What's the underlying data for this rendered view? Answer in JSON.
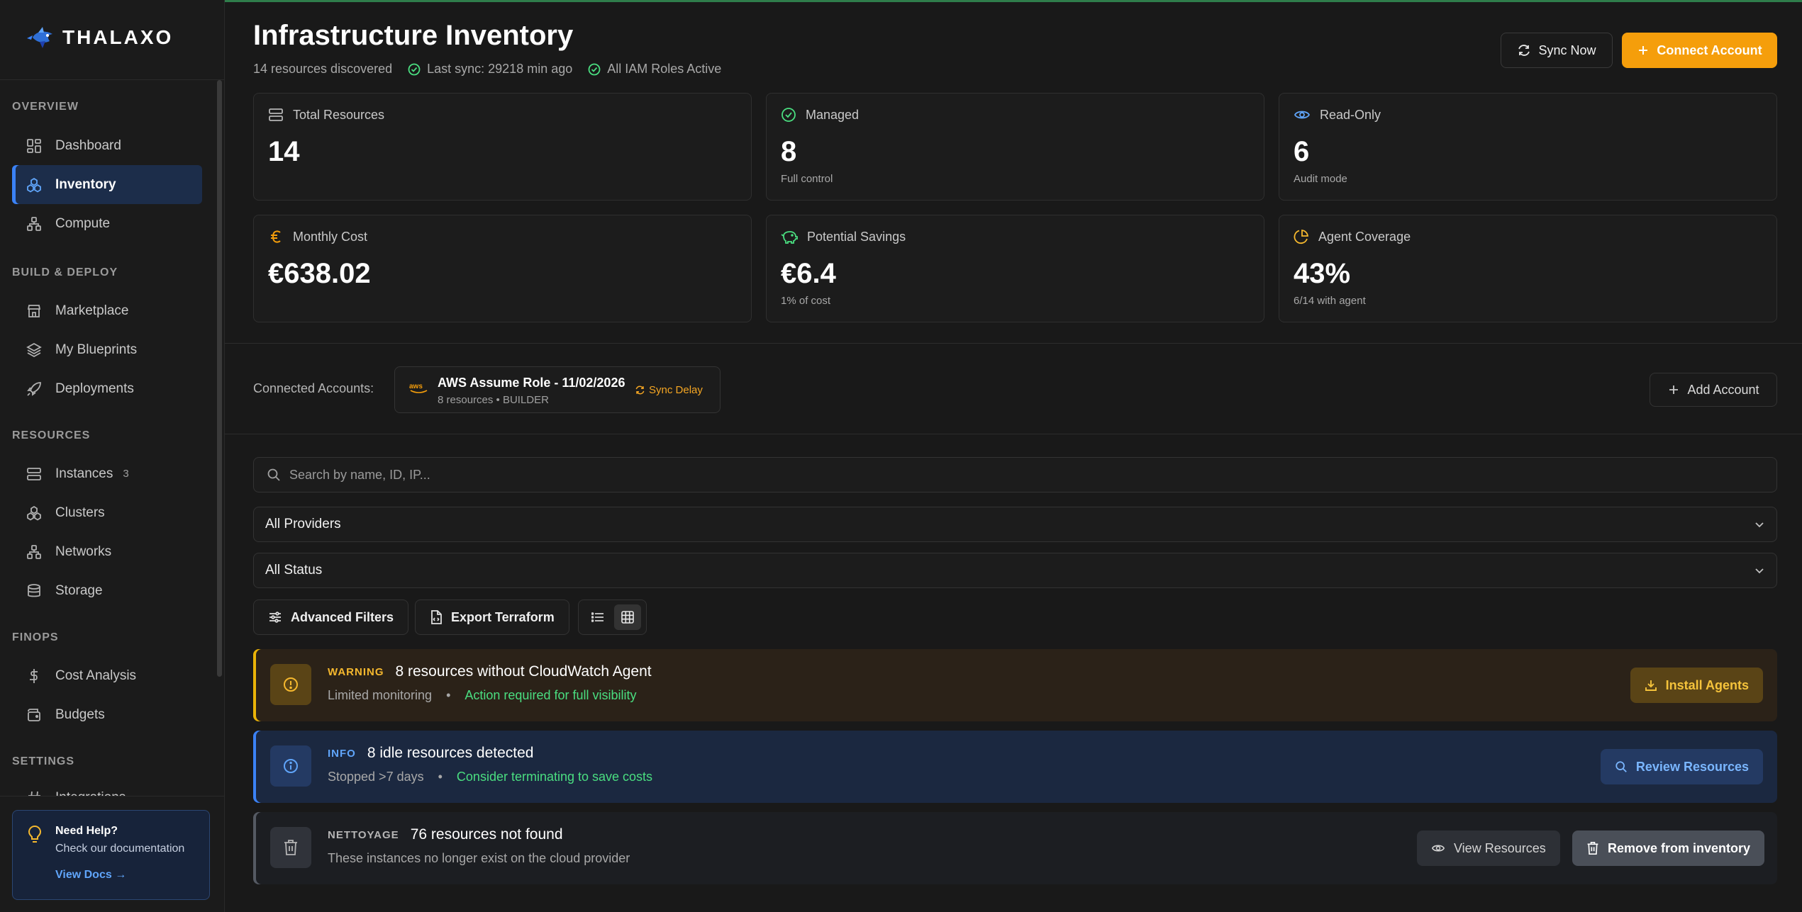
{
  "app": {
    "name": "THALAXO"
  },
  "sidebar": {
    "sections": {
      "overview": "OVERVIEW",
      "build": "BUILD & DEPLOY",
      "resources": "RESOURCES",
      "finops": "FINOPS",
      "settings": "SETTINGS"
    },
    "items": [
      {
        "label": "Dashboard",
        "icon": "dashboard-icon"
      },
      {
        "label": "Inventory",
        "icon": "inventory-icon",
        "active": true
      },
      {
        "label": "Compute",
        "icon": "compute-icon"
      },
      {
        "label": "Marketplace",
        "icon": "store-icon"
      },
      {
        "label": "My Blueprints",
        "icon": "layers-icon"
      },
      {
        "label": "Deployments",
        "icon": "rocket-icon"
      },
      {
        "label": "Instances",
        "icon": "server-icon",
        "badge": "3"
      },
      {
        "label": "Clusters",
        "icon": "cluster-icon"
      },
      {
        "label": "Networks",
        "icon": "network-icon"
      },
      {
        "label": "Storage",
        "icon": "database-icon"
      },
      {
        "label": "Cost Analysis",
        "icon": "dollar-icon"
      },
      {
        "label": "Budgets",
        "icon": "wallet-icon"
      },
      {
        "label": "Integrations",
        "icon": "hash-icon"
      }
    ],
    "help": {
      "title": "Need Help?",
      "subtitle": "Check our documentation",
      "link": "View Docs →"
    }
  },
  "header": {
    "title": "Infrastructure Inventory",
    "discovered": "14 resources discovered",
    "last_sync": "Last sync: 29218 min ago",
    "iam": "All IAM Roles Active",
    "sync_button": "Sync Now",
    "connect_button": "Connect Account"
  },
  "stats": [
    {
      "label": "Total Resources",
      "value": "14",
      "sub": "",
      "icon": "server-icon",
      "color": "#b5b5b5"
    },
    {
      "label": "Managed",
      "value": "8",
      "sub": "Full control",
      "icon": "check-circle-icon",
      "color": "#4ade80"
    },
    {
      "label": "Read-Only",
      "value": "6",
      "sub": "Audit mode",
      "icon": "eye-icon",
      "color": "#60a5fa"
    },
    {
      "label": "Monthly Cost",
      "value": "€638.02",
      "sub": "",
      "icon": "euro-icon",
      "color": "#f59e0b"
    },
    {
      "label": "Potential Savings",
      "value": "€6.4",
      "sub": "1% of cost",
      "icon": "piggy-bank-icon",
      "color": "#4ade80"
    },
    {
      "label": "Agent Coverage",
      "value": "43%",
      "sub": "6/14 with agent",
      "icon": "pie-chart-icon",
      "color": "#f5b82e"
    }
  ],
  "accounts": {
    "label": "Connected Accounts:",
    "items": [
      {
        "provider": "aws",
        "name": "AWS Assume Role - 11/02/2026",
        "meta": "8 resources • BUILDER",
        "status": "Sync Delay"
      }
    ],
    "add_button": "Add Account"
  },
  "filters": {
    "search_placeholder": "Search by name, ID, IP...",
    "provider": "All Providers",
    "status": "All Status",
    "advanced": "Advanced Filters",
    "export": "Export Terraform"
  },
  "alerts": [
    {
      "tag": "WARNING",
      "title": "8 resources without CloudWatch Agent",
      "sub": "Limited monitoring",
      "action_text": "Action required for full visibility",
      "button": "Install Agents"
    },
    {
      "tag": "INFO",
      "title": "8 idle resources detected",
      "sub": "Stopped >7 days",
      "action_text": "Consider terminating to save costs",
      "button": "Review Resources"
    },
    {
      "tag": "NETTOYAGE",
      "title": "76 resources not found",
      "sub": "These instances no longer exist on the cloud provider",
      "button_view": "View Resources",
      "button_remove": "Remove from inventory"
    }
  ]
}
